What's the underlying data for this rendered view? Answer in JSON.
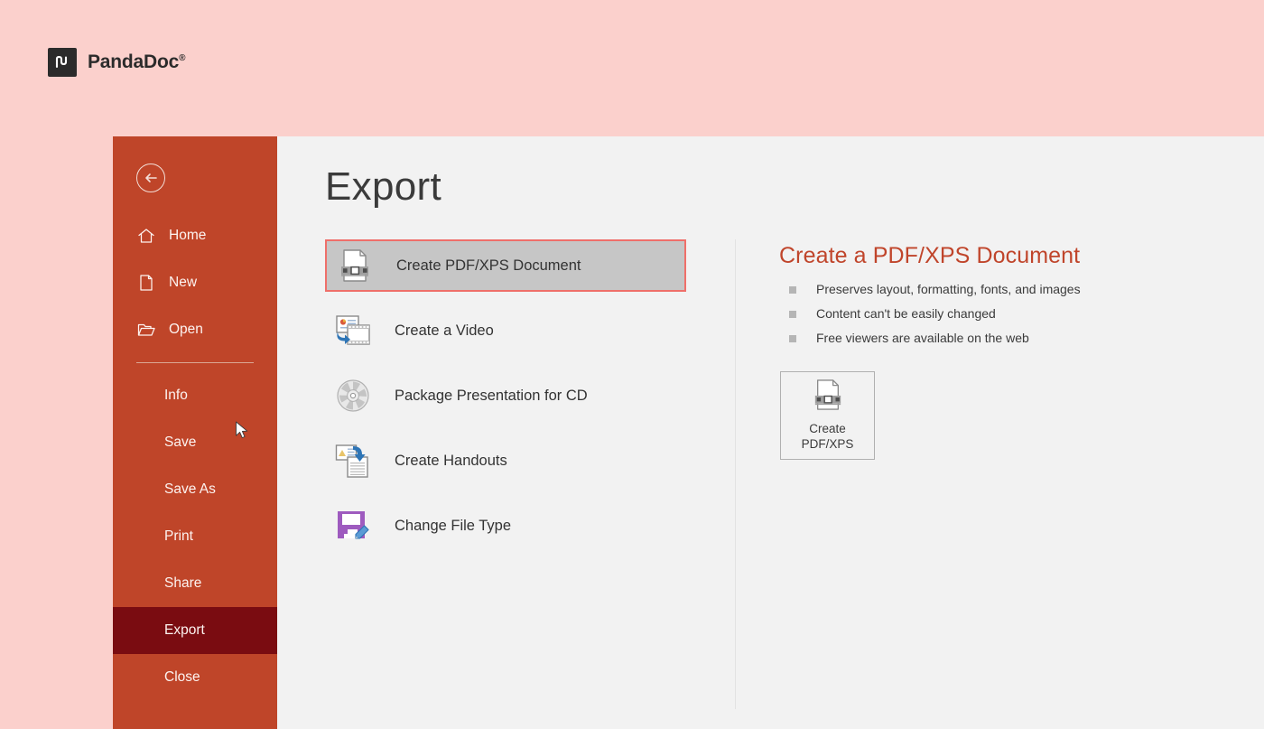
{
  "brand": {
    "mark": "pd-monogram-icon",
    "name": "PandaDoc",
    "trademark": "®"
  },
  "sidebar": {
    "back": {
      "label": "Back",
      "icon": "back-circle-arrow-icon"
    },
    "nav_icons": [
      {
        "label": "Home",
        "icon": "home-icon"
      },
      {
        "label": "New",
        "icon": "new-document-icon"
      },
      {
        "label": "Open",
        "icon": "open-folder-icon"
      }
    ],
    "nav_items": [
      {
        "label": "Info",
        "active": false
      },
      {
        "label": "Save",
        "active": false
      },
      {
        "label": "Save As",
        "active": false
      },
      {
        "label": "Print",
        "active": false
      },
      {
        "label": "Share",
        "active": false
      },
      {
        "label": "Export",
        "active": true
      },
      {
        "label": "Close",
        "active": false
      }
    ],
    "cursor": "mouse-pointer-icon",
    "colors": {
      "background": "#bf4529",
      "active": "#7a0c11",
      "text": "#fdf3f0"
    }
  },
  "main": {
    "title": "Export",
    "options": [
      {
        "label": "Create PDF/XPS Document",
        "icon": "pdf-xps-document-icon",
        "selected": true
      },
      {
        "label": "Create a Video",
        "icon": "video-film-icon",
        "selected": false
      },
      {
        "label": "Package Presentation for CD",
        "icon": "cd-disc-icon",
        "selected": false
      },
      {
        "label": "Create Handouts",
        "icon": "handouts-icon",
        "selected": false
      },
      {
        "label": "Change File Type",
        "icon": "floppy-pencil-icon",
        "selected": false
      }
    ],
    "detail": {
      "title": "Create a PDF/XPS Document",
      "bullets": [
        "Preserves layout, formatting, fonts, and images",
        "Content can't be easily changed",
        "Free viewers are available on the web"
      ],
      "action_button": {
        "line1": "Create",
        "line2": "PDF/XPS",
        "icon": "pdf-xps-document-icon"
      }
    },
    "colors": {
      "background": "#f2f2f2",
      "accent": "#c0452b",
      "selection_border": "#ef6f6a",
      "selection_fill": "#c6c6c6"
    }
  }
}
